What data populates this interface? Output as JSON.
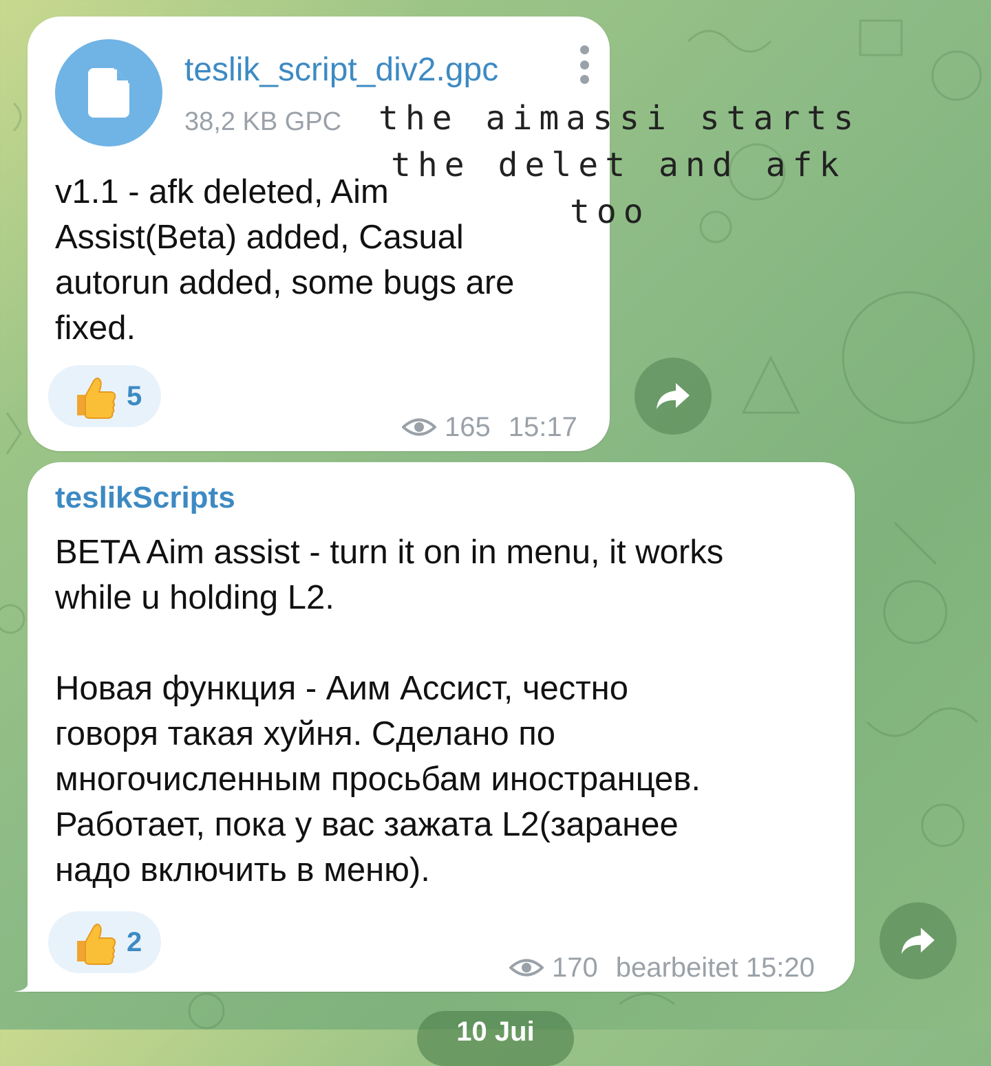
{
  "colors": {
    "bubble": "#ffffff",
    "accent": "#3d8ac3",
    "file_icon_bg": "#6fb4e5",
    "meta": "#9aa1a8",
    "reaction_bg": "#e8f2fb"
  },
  "messages": [
    {
      "file": {
        "icon": "document-icon",
        "name": "teslik_script_div2.gpc",
        "meta": "38,2 KB GPC"
      },
      "text": "v1.1 -  afk deleted, Aim\nAssist(Beta) added, Casual\nautorun added, some bugs are\nfixed.",
      "reaction": {
        "emoji": "thumbs-up-icon",
        "count": "5"
      },
      "views": "165",
      "time": "15:17"
    },
    {
      "sender": "teslikScripts",
      "text": "BETA Aim assist - turn it on in menu, it works\nwhile u holding L2.\n\nНовая функция - Аим Ассист, честно\nговоря такая хуйня. Сделано по\nмногочисленным просьбам иностранцев.\nРаботает, пока у вас зажата L2(заранее\nнадо включить в меню).",
      "reaction": {
        "emoji": "thumbs-up-icon",
        "count": "2"
      },
      "views": "170",
      "edited_time": "bearbeitet 15:20"
    }
  ],
  "overlay": {
    "line1": "the aimassi starts",
    "line2": "the delet and afk",
    "line3": "too"
  },
  "date_pill": "10 Jui"
}
